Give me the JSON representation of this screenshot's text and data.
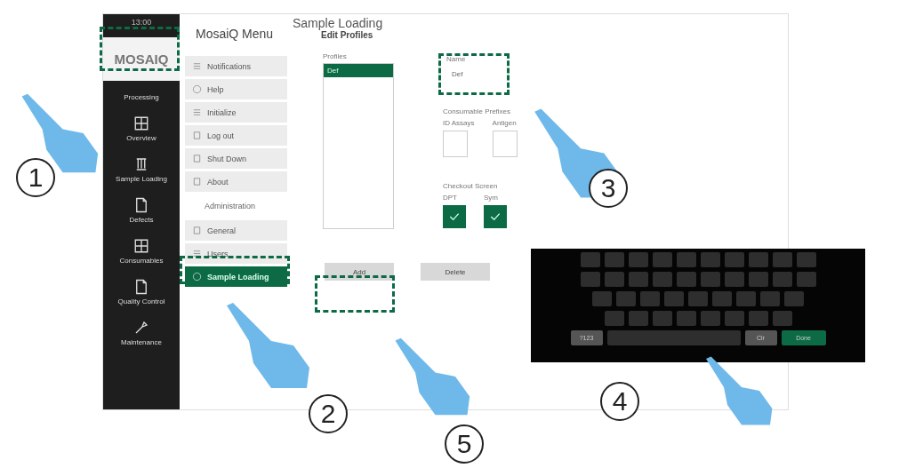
{
  "sidebar": {
    "time": "13:00",
    "logo": "MOSAIQ",
    "items": [
      {
        "label": "Processing",
        "selected": false
      },
      {
        "label": "Overview",
        "selected": false
      },
      {
        "label": "Sample Loading",
        "selected": false
      },
      {
        "label": "Defects",
        "selected": false
      },
      {
        "label": "Consumables",
        "selected": false
      },
      {
        "label": "Quality Control",
        "selected": false
      },
      {
        "label": "Maintenance",
        "selected": false
      }
    ]
  },
  "menu": {
    "title": "MosaiQ Menu",
    "items": [
      {
        "kind": "item",
        "label": "Notifications",
        "selected": false
      },
      {
        "kind": "item",
        "label": "Help",
        "selected": false
      },
      {
        "kind": "item",
        "label": "Initialize",
        "selected": false
      },
      {
        "kind": "item",
        "label": "Log out",
        "selected": false
      },
      {
        "kind": "item",
        "label": "Shut Down",
        "selected": false
      },
      {
        "kind": "item",
        "label": "About",
        "selected": false
      },
      {
        "kind": "heading",
        "label": "Administration"
      },
      {
        "kind": "item",
        "label": "General",
        "selected": false
      },
      {
        "kind": "item",
        "label": "Users",
        "selected": false
      },
      {
        "kind": "item",
        "label": "Sample Loading",
        "selected": true
      }
    ]
  },
  "content": {
    "title": "Sample Loading",
    "subtitle": "Edit Profiles",
    "profiles": {
      "label": "Profiles",
      "items": [
        {
          "label": "Def",
          "selected": true
        }
      ]
    },
    "name": {
      "label": "Name",
      "value": "Def"
    },
    "consumables": {
      "label": "Consumable Prefixes",
      "fields": [
        {
          "label": "ID Assays"
        },
        {
          "label": "Antigen"
        }
      ]
    },
    "checks": {
      "label": "Checkout Screen",
      "items": [
        {
          "label": "DPT",
          "checked": true
        },
        {
          "label": "Sym",
          "checked": true
        }
      ]
    },
    "buttons": [
      "Add",
      "Delete"
    ]
  },
  "keyboard": {
    "bottom": [
      {
        "kind": "key",
        "label": "?123"
      },
      {
        "kind": "key",
        "label": "Clr"
      },
      {
        "kind": "enter",
        "label": "Done"
      }
    ]
  },
  "callouts": [
    "1",
    "2",
    "3",
    "4",
    "5"
  ]
}
